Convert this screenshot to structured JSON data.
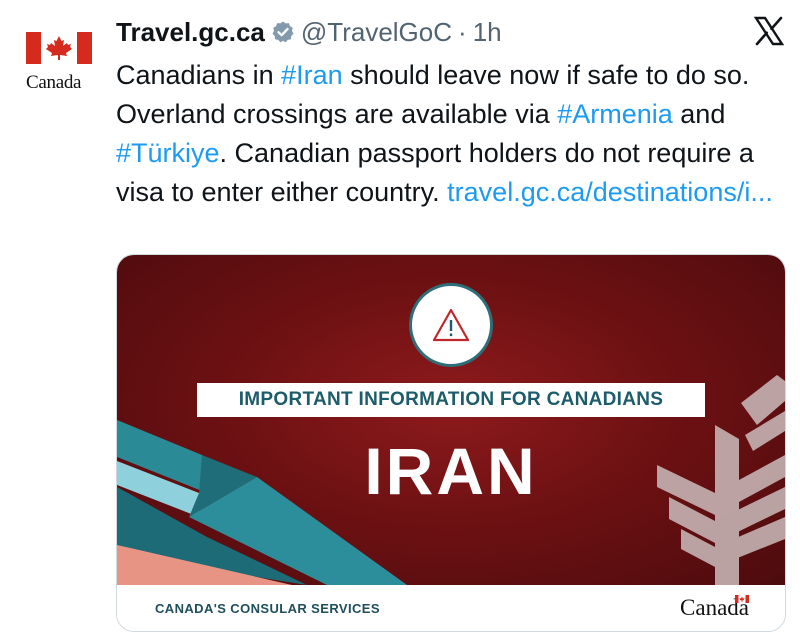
{
  "tweet": {
    "display_name": "Travel.gc.ca",
    "handle": "@TravelGoC",
    "separator": "·",
    "time": "1h",
    "avatar_wordmark": "Canada",
    "text_parts": [
      {
        "t": "Canadians in ",
        "kind": "text"
      },
      {
        "t": "#Iran",
        "kind": "hashtag"
      },
      {
        "t": " should leave now if safe to do so. Overland crossings are available via ",
        "kind": "text"
      },
      {
        "t": "#Armenia",
        "kind": "hashtag"
      },
      {
        "t": " and ",
        "kind": "text"
      },
      {
        "t": "#Türkiye",
        "kind": "hashtag"
      },
      {
        "t": ". Canadian passport holders do not require a visa to enter either country. ",
        "kind": "text"
      },
      {
        "t": "travel.gc.ca/destinations/i...",
        "kind": "link"
      }
    ]
  },
  "card": {
    "banner": "IMPORTANT INFORMATION FOR CANADIANS",
    "country": "IRAN",
    "footer_label": "CANADA'S CONSULAR SERVICES",
    "footer_wordmark": "Canada"
  },
  "colors": {
    "accent": "#1d9bf0",
    "card_red": "#6e1113",
    "teal": "#1d5c6a",
    "flag_red": "#d52b1e"
  },
  "icons": {
    "verified": "verified-badge-icon",
    "x": "x-logo-icon",
    "warning": "warning-triangle-icon"
  }
}
